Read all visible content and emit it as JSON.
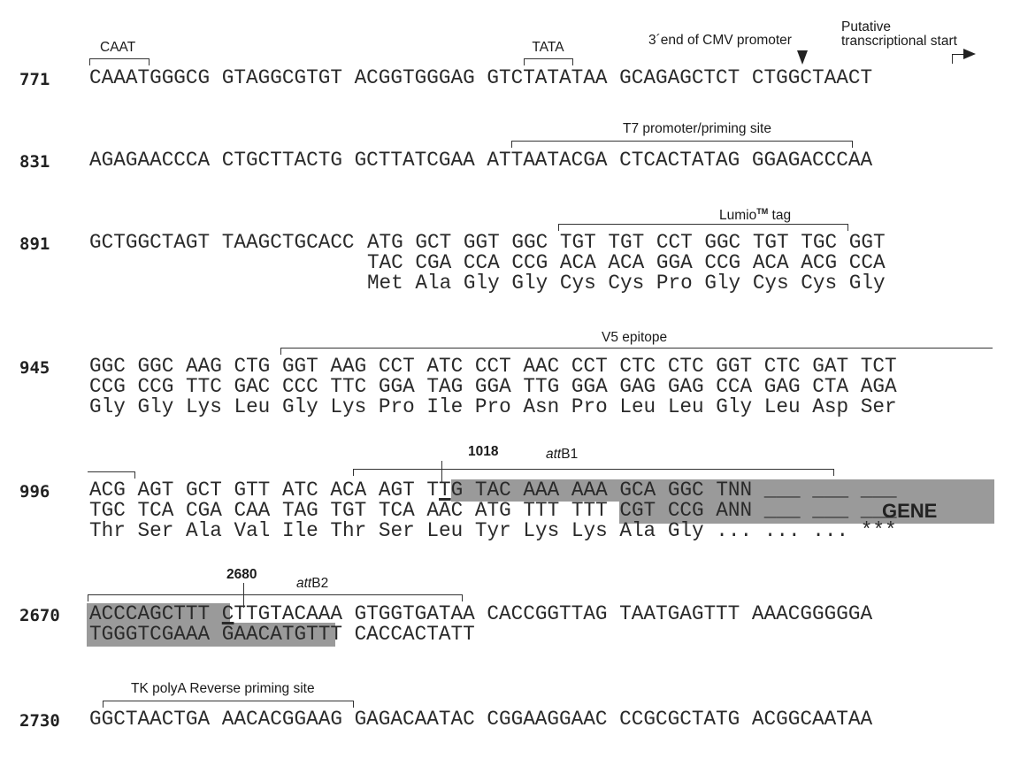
{
  "figure": {
    "blocks": [
      {
        "position": "771",
        "top_strand": [
          "CAAATGGGCG",
          "GTAGGCGTGT",
          "ACGGTGGGAG",
          "GTCTATATAA",
          "GCAGAGCTCT",
          "CTGGCTAACT"
        ],
        "annotations": [
          {
            "label": "CAAT",
            "type": "bracket"
          },
          {
            "label": "TATA",
            "type": "bracket"
          },
          {
            "label": "3´end of CMV promoter",
            "type": "arrowhead-down"
          },
          {
            "label_line1": "Putative",
            "label_line2": "transcriptional start",
            "type": "bent-arrow"
          }
        ]
      },
      {
        "position": "831",
        "top_strand": [
          "AGAGAACCCA",
          "CTGCTTACTG",
          "GCTTATCGAA",
          "ATTAATACGA",
          "CTCACTATAG",
          "GGAGACCCAA"
        ],
        "annotations": [
          {
            "label": "T7 promoter/priming site",
            "type": "bracket"
          }
        ]
      },
      {
        "position": "891",
        "top_strand_prefix": [
          "GCTGGCTAGT",
          "TAAGCTGCACC"
        ],
        "top_codons": [
          "ATG",
          "GCT",
          "GGT",
          "GGC",
          "TGT",
          "TGT",
          "CCT",
          "GGC",
          "TGT",
          "TGC",
          "GGT"
        ],
        "bottom_codons": [
          "TAC",
          "CGA",
          "CCA",
          "CCG",
          "ACA",
          "ACA",
          "GGA",
          "CCG",
          "ACA",
          "ACG",
          "CCA"
        ],
        "amino_acids": [
          "Met",
          "Ala",
          "Gly",
          "Gly",
          "Cys",
          "Cys",
          "Pro",
          "Gly",
          "Cys",
          "Cys",
          "Gly"
        ],
        "annotations": [
          {
            "label": "Lumio",
            "superscript": "TM",
            "label_suffix": " tag",
            "type": "bracket"
          }
        ]
      },
      {
        "position": "945",
        "top_codons": [
          "GGC",
          "GGC",
          "AAG",
          "CTG",
          "GGT",
          "AAG",
          "CCT",
          "ATC",
          "CCT",
          "AAC",
          "CCT",
          "CTC",
          "CTC",
          "GGT",
          "CTC",
          "GAT",
          "TCT"
        ],
        "bottom_codons": [
          "CCG",
          "CCG",
          "TTC",
          "GAC",
          "CCC",
          "TTC",
          "GGA",
          "TAG",
          "GGA",
          "TTG",
          "GGA",
          "GAG",
          "GAG",
          "CCA",
          "GAG",
          "CTA",
          "AGA"
        ],
        "amino_acids": [
          "Gly",
          "Gly",
          "Lys",
          "Leu",
          "Gly",
          "Lys",
          "Pro",
          "Ile",
          "Pro",
          "Asn",
          "Pro",
          "Leu",
          "Leu",
          "Gly",
          "Leu",
          "Asp",
          "Ser"
        ],
        "annotations": [
          {
            "label": "V5 epitope",
            "type": "bracket"
          }
        ]
      },
      {
        "position": "996",
        "top_codons": [
          "ACG",
          "AGT",
          "GCT",
          "GTT",
          "ATC",
          "ACA",
          "AGT",
          "TTG",
          "TAC",
          "AAA",
          "AAA",
          "GCA",
          "GGC",
          "TNN",
          "___",
          "___",
          "___"
        ],
        "bottom_codons": [
          "TGC",
          "TCA",
          "CGA",
          "CAA",
          "TAG",
          "TGT",
          "TCA",
          "AAC",
          "ATG",
          "TTT",
          "TTT",
          "CGT",
          "CCG",
          "ANN",
          "___",
          "___",
          "___"
        ],
        "amino_acids": [
          "Thr",
          "Ser",
          "Ala",
          "Val",
          "Ile",
          "Thr",
          "Ser",
          "Leu",
          "Tyr",
          "Lys",
          "Lys",
          "Ala",
          "Gly",
          "...",
          "...",
          "...",
          "***"
        ],
        "gene_label": "GENE",
        "site_marker": "1018",
        "annotations": [
          {
            "label": "attB1",
            "italic_part": "att",
            "plain_part": "B1",
            "type": "bracket"
          }
        ]
      },
      {
        "position": "2670",
        "top_strand": [
          "ACCCAGCTTT",
          "CTTGTACAAA",
          "GTGGTGATAA",
          "CACCGGTTAG",
          "TAATGAGTTT",
          "AAACGGGGGA"
        ],
        "bottom_strand": [
          "TGGGTCGAAA",
          "GAACATGTTT",
          "CACCACTATT"
        ],
        "site_marker": "2680",
        "annotations": [
          {
            "label": "attB2",
            "italic_part": "att",
            "plain_part": "B2",
            "type": "bracket"
          }
        ]
      },
      {
        "position": "2730",
        "top_strand": [
          "GGCTAACTGA",
          "AACACGGAAG",
          "GAGACAATAC",
          "CGGAAGGAAC",
          "CCGCGCTATG",
          "ACGGCAATAA"
        ],
        "annotations": [
          {
            "label": "TK polyA Reverse priming site",
            "type": "bracket"
          }
        ]
      }
    ],
    "colors": {
      "shade": "#9a9a9a",
      "text": "#2a2a2a"
    }
  }
}
